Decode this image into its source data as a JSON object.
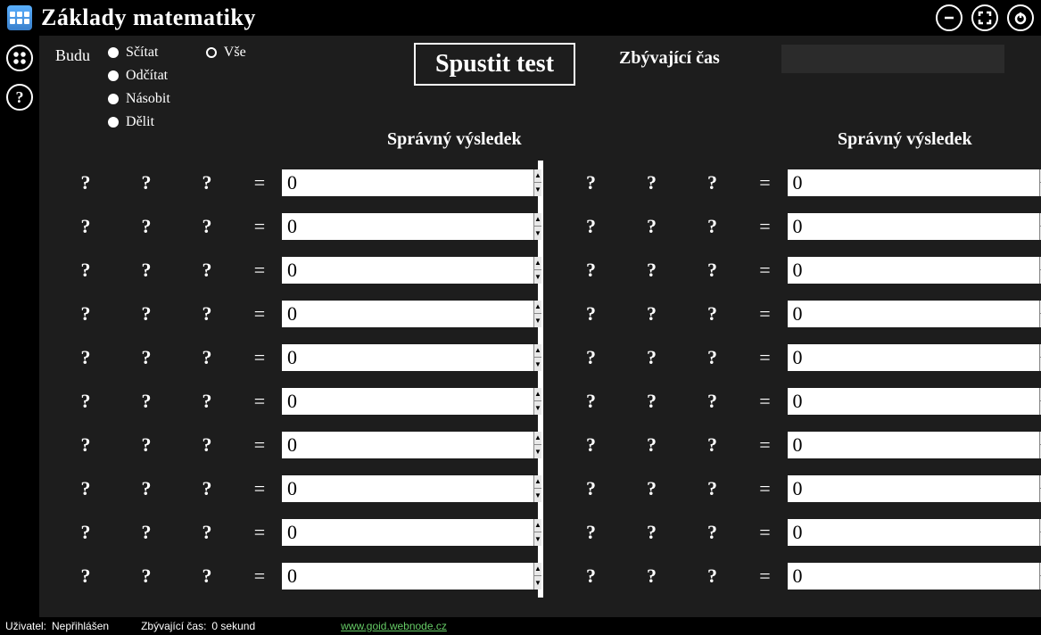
{
  "app": {
    "title": "Základy matematiky"
  },
  "controls": {
    "budu_label": "Budu",
    "ops": [
      "Sčítat",
      "Odčítat",
      "Násobit",
      "Dělit"
    ],
    "vse": "Vše",
    "start_label": "Spustit test",
    "time_label": "Zbývající čas",
    "result_header": "Správný výsledek"
  },
  "placeholder": "?",
  "equals": "=",
  "spinner_default": "0",
  "rows_per_col": 10,
  "statusbar": {
    "user_label": "Uživatel:",
    "user_value": "Nepřihlášen",
    "time_label": "Zbývající čas:",
    "time_value": "0 sekund",
    "link": "www.goid.webnode.cz"
  }
}
